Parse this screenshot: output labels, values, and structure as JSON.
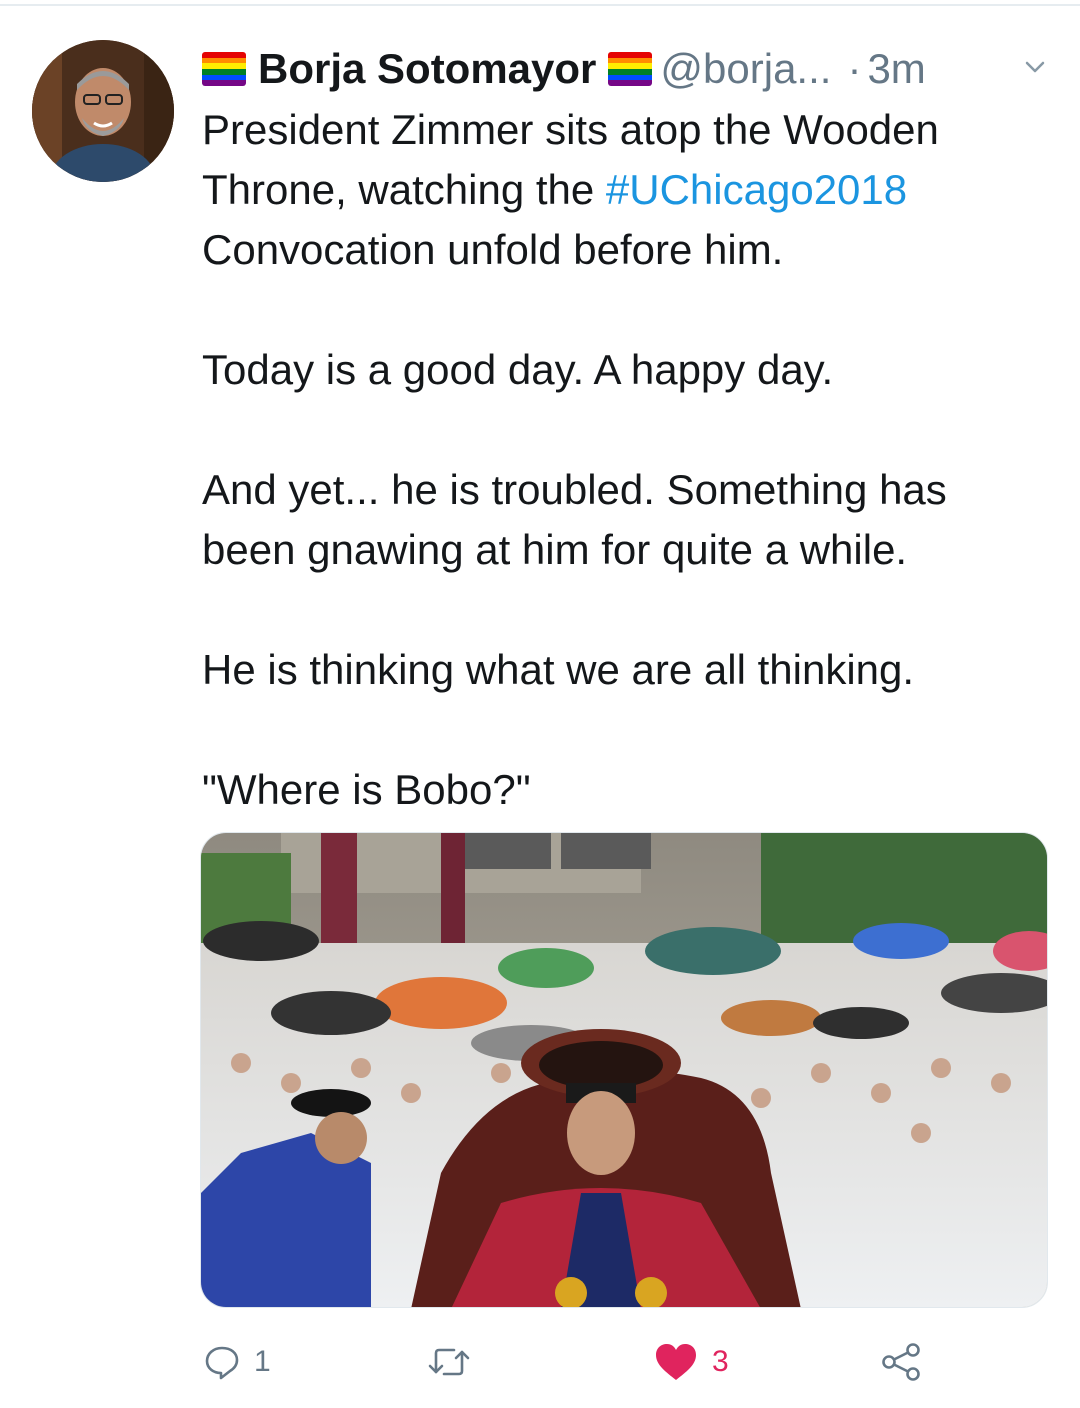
{
  "tweet": {
    "author_name": "Borja Sotomayor",
    "author_handle": "@borja...",
    "separator": "·",
    "time": "3m",
    "text_line_1a": "President Zimmer sits atop the Wooden",
    "text_line_2a": "Throne, watching the ",
    "hashtag": "#UChicago2018",
    "text_line_3a": "Convocation unfold before him.",
    "text_para_2": "Today is a good day. A happy day.",
    "text_para_3_line_1": "And yet... he is troubled. Something has",
    "text_para_3_line_2": "been gnawing at him for quite a while.",
    "text_para_4": "He is thinking what we are all thinking.",
    "text_para_5": "\"Where is Bobo?\""
  },
  "actions": {
    "reply_count": "1",
    "retweet_count": "",
    "like_count": "3"
  },
  "colors": {
    "link": "#1b95e0",
    "muted": "#657786",
    "like": "#e0245e",
    "text": "#14171a"
  },
  "icons": [
    "rainbow-flag-icon",
    "chevron-down-icon",
    "reply-icon",
    "retweet-icon",
    "heart-icon",
    "share-icon"
  ]
}
